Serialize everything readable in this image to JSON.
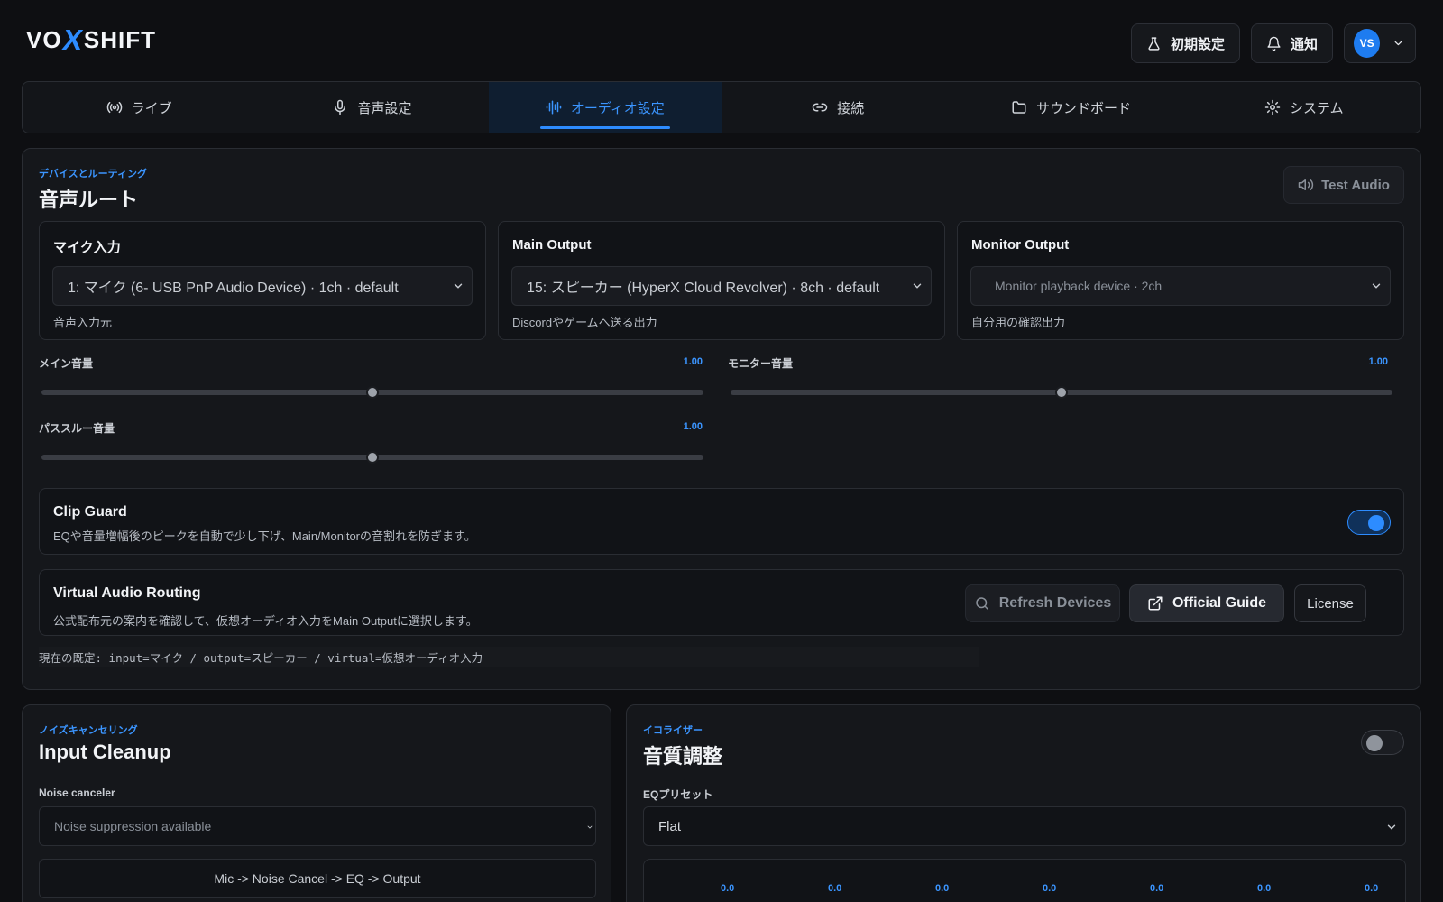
{
  "brand": {
    "left": "VO",
    "x": "X",
    "right": "SHIFT"
  },
  "header": {
    "setup_label": "初期設定",
    "notify_label": "通知",
    "avatar_initials": "VS"
  },
  "tabs": [
    {
      "label": "ライブ",
      "icon": "broadcast-icon",
      "active": false
    },
    {
      "label": "音声設定",
      "icon": "microphone-icon",
      "active": false
    },
    {
      "label": "オーディオ設定",
      "icon": "audio-wave-icon",
      "active": true
    },
    {
      "label": "接続",
      "icon": "link-icon",
      "active": false
    },
    {
      "label": "サウンドボード",
      "icon": "folder-icon",
      "active": false
    },
    {
      "label": "システム",
      "icon": "gear-icon",
      "active": false
    }
  ],
  "routing": {
    "eyebrow": "デバイスとルーティング",
    "title": "音声ルート",
    "test_button": "Test Audio",
    "devices": [
      {
        "label": "マイク入力",
        "value": "1: マイク (6- USB PnP Audio Device) · 1ch · default",
        "hint": "音声入力元"
      },
      {
        "label": "Main Output",
        "value": "15: スピーカー (HyperX Cloud Revolver) · 8ch · default",
        "hint": "Discordやゲームへ送る出力"
      },
      {
        "label": "Monitor Output",
        "value": "Monitor playback device · 2ch",
        "hint": "自分用の確認出力"
      }
    ],
    "sliders": {
      "main": {
        "label": "メイン音量",
        "value": "1.00",
        "level": 0.5
      },
      "monitor": {
        "label": "モニター音量",
        "value": "1.00",
        "level": 0.5
      },
      "passthrough": {
        "label": "パススルー音量",
        "value": "1.00",
        "level": 0.5
      }
    },
    "clip_guard": {
      "title": "Clip Guard",
      "desc": "EQや音量増幅後のピークを自動で少し下げ、Main/Monitorの音割れを防ぎます。",
      "enabled": true
    },
    "virtual": {
      "title": "Virtual Audio Routing",
      "desc": "公式配布元の案内を確認して、仮想オーディオ入力をMain Outputに選択します。",
      "refresh_label": "Refresh Devices",
      "guide_label": "Official Guide",
      "license_label": "License"
    },
    "status": "現在の既定: input=マイク / output=スピーカー / virtual=仮想オーディオ入力"
  },
  "cleanup": {
    "eyebrow": "ノイズキャンセリング",
    "title": "Input Cleanup",
    "nc_label": "Noise canceler",
    "nc_value": "Noise suppression available",
    "chain": "Mic -> Noise Cancel -> EQ -> Output"
  },
  "eq": {
    "eyebrow": "イコライザー",
    "title": "音質調整",
    "enabled": false,
    "preset_label": "EQプリセット",
    "preset_value": "Flat",
    "bands": [
      "0.0",
      "0.0",
      "0.0",
      "0.0",
      "0.0",
      "0.0",
      "0.0"
    ]
  },
  "colors": {
    "accent": "#2d8cff",
    "bg": "#0e0f12",
    "panel": "#15171b"
  }
}
